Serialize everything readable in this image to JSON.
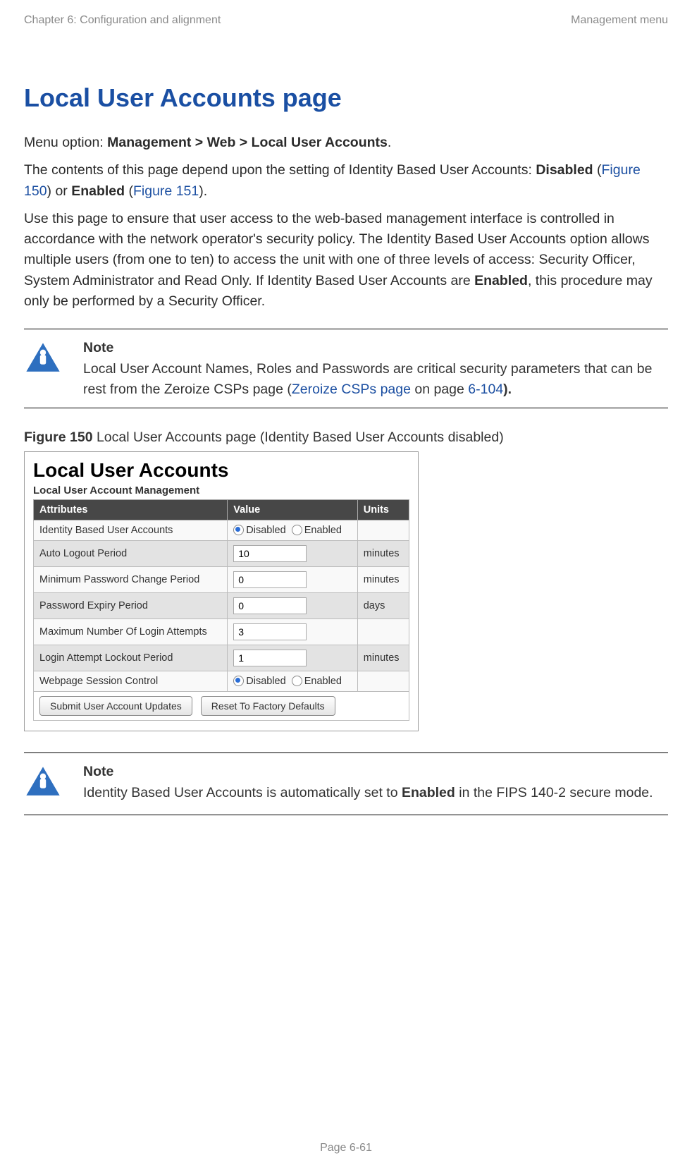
{
  "header": {
    "left": "Chapter 6:  Configuration and alignment",
    "right": "Management menu"
  },
  "title": "Local User Accounts page",
  "intro": {
    "line1_prefix": "Menu option: ",
    "line1_bold": "Management > Web > Local User Accounts",
    "line1_suffix": ".",
    "line2_a": "The contents of this page depend upon the setting of Identity Based User Accounts: ",
    "line2_b": "Disabled",
    "line2_c": " (",
    "line2_d": "Figure 150",
    "line2_e": ") or ",
    "line2_f": "Enabled",
    "line2_g": " (",
    "line2_h": "Figure 151",
    "line2_i": ").",
    "line3_a": "Use this page to ensure that user access to the web-based management interface is controlled in accordance with the network operator's security policy. The Identity Based User Accounts option allows multiple users (from one to ten) to access the unit with one of three levels of access: Security Officer, System Administrator and Read Only. If Identity Based User Accounts are ",
    "line3_b": "Enabled",
    "line3_c": ", this procedure may only be performed by a Security Officer."
  },
  "note1": {
    "heading": "Note",
    "a": "Local User Account Names, Roles and Passwords are critical security parameters that can be rest from the Zeroize CSPs page (",
    "link": "Zeroize CSPs page",
    "b": " on page ",
    "pageref": "6-104",
    "c": ")."
  },
  "figure": {
    "label": "Figure 150",
    "caption": "  Local User Accounts page (Identity Based User Accounts disabled)"
  },
  "embed": {
    "title": "Local User Accounts",
    "subtitle": "Local User Account Management",
    "cols": {
      "c1": "Attributes",
      "c2": "Value",
      "c3": "Units"
    },
    "rows": [
      {
        "attr": "Identity Based User Accounts",
        "type": "radio",
        "opt1": "Disabled",
        "opt2": "Enabled",
        "units": ""
      },
      {
        "attr": "Auto Logout Period",
        "type": "input",
        "value": "10",
        "units": "minutes"
      },
      {
        "attr": "Minimum Password Change Period",
        "type": "input",
        "value": "0",
        "units": "minutes"
      },
      {
        "attr": "Password Expiry Period",
        "type": "input",
        "value": "0",
        "units": "days"
      },
      {
        "attr": "Maximum Number Of Login Attempts",
        "type": "input",
        "value": "3",
        "units": ""
      },
      {
        "attr": "Login Attempt Lockout Period",
        "type": "input",
        "value": "1",
        "units": "minutes"
      },
      {
        "attr": "Webpage Session Control",
        "type": "radio",
        "opt1": "Disabled",
        "opt2": "Enabled",
        "units": ""
      }
    ],
    "buttons": {
      "b1": "Submit User Account Updates",
      "b2": "Reset To Factory Defaults"
    }
  },
  "note2": {
    "heading": "Note",
    "a": "Identity Based User Accounts is automatically set to ",
    "b": "Enabled",
    "c": " in the FIPS 140-2 secure mode."
  },
  "footer": "Page 6-61"
}
